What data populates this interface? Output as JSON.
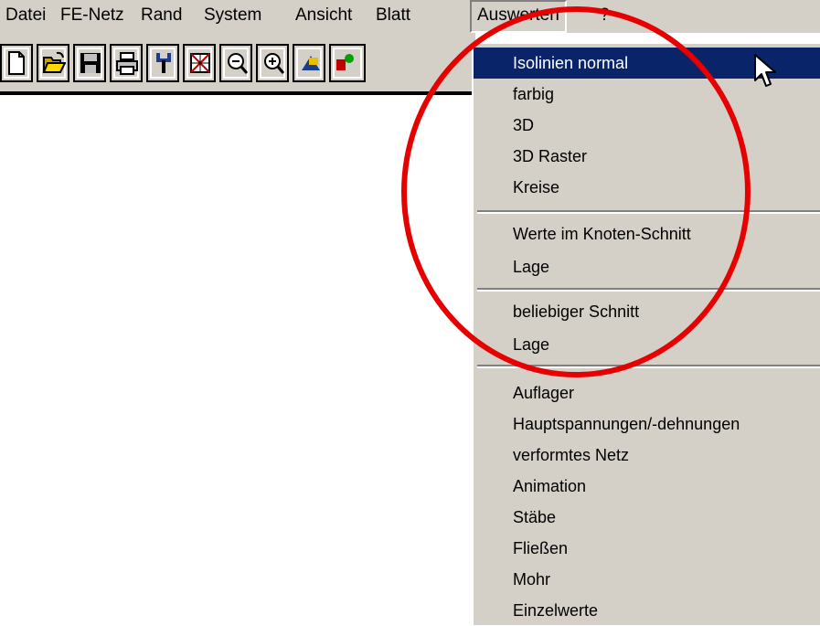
{
  "menubar": {
    "items": [
      "Datei",
      "FE-Netz",
      "Rand",
      "System",
      "Ansicht",
      "Blatt",
      "Auswerten",
      "?"
    ]
  },
  "toolbar": {
    "buttons": [
      {
        "icon": "new-document-icon"
      },
      {
        "icon": "open-folder-icon"
      },
      {
        "icon": "save-disk-icon"
      },
      {
        "icon": "print-icon"
      },
      {
        "icon": "tools-icon"
      },
      {
        "icon": "delete-grid-icon"
      },
      {
        "icon": "zoom-out-icon"
      },
      {
        "icon": "zoom-in-icon"
      },
      {
        "icon": "shape-icon"
      },
      {
        "icon": "color-shapes-icon"
      }
    ]
  },
  "dropdown": {
    "menu": "Auswerten",
    "selected": "Isolinien normal",
    "groups": [
      [
        "Isolinien normal",
        "farbig",
        "3D",
        "3D Raster",
        "Kreise"
      ],
      [
        "Werte im Knoten-Schnitt",
        "Lage"
      ],
      [
        "beliebiger Schnitt",
        "Lage"
      ],
      [
        "Auflager",
        "Hauptspannungen/-dehnungen",
        "verformtes Netz",
        "Animation",
        "Stäbe",
        "Fließen",
        "Mohr",
        "Einzelwerte"
      ]
    ]
  },
  "colors": {
    "menu_bg": "#d4d0c8",
    "highlight": "#0a246a",
    "annotation_circle": "#e60000"
  }
}
